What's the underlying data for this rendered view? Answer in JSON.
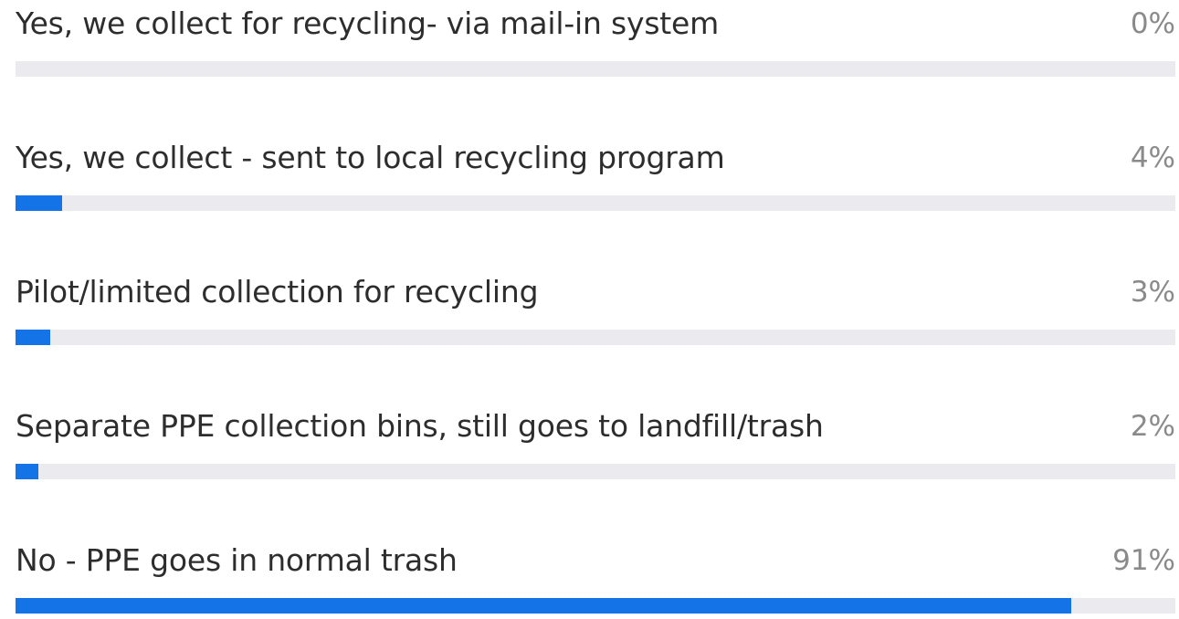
{
  "colors": {
    "bar_fill": "#1473e6",
    "bar_track": "#ebebef",
    "label_text": "#2d2d2d",
    "pct_text": "#8a8a8a"
  },
  "poll": {
    "options": [
      {
        "label": "Yes, we collect for recycling- via mail-in system",
        "percent_label": "0%"
      },
      {
        "label": "Yes, we collect - sent to local recycling program",
        "percent_label": "4%"
      },
      {
        "label": "Pilot/limited collection for recycling",
        "percent_label": "3%"
      },
      {
        "label": "Separate PPE collection bins, still goes to landfill/trash",
        "percent_label": "2%"
      },
      {
        "label": "No - PPE goes in normal trash",
        "percent_label": "91%"
      }
    ]
  },
  "chart_data": {
    "type": "bar",
    "orientation": "horizontal",
    "categories": [
      "Yes, we collect for recycling- via mail-in system",
      "Yes, we collect - sent to local recycling program",
      "Pilot/limited collection for recycling",
      "Separate PPE collection bins, still goes to landfill/trash",
      "No - PPE goes in normal trash"
    ],
    "values": [
      0,
      4,
      3,
      2,
      91
    ],
    "unit": "%",
    "xlim": [
      0,
      100
    ],
    "grid": false
  }
}
